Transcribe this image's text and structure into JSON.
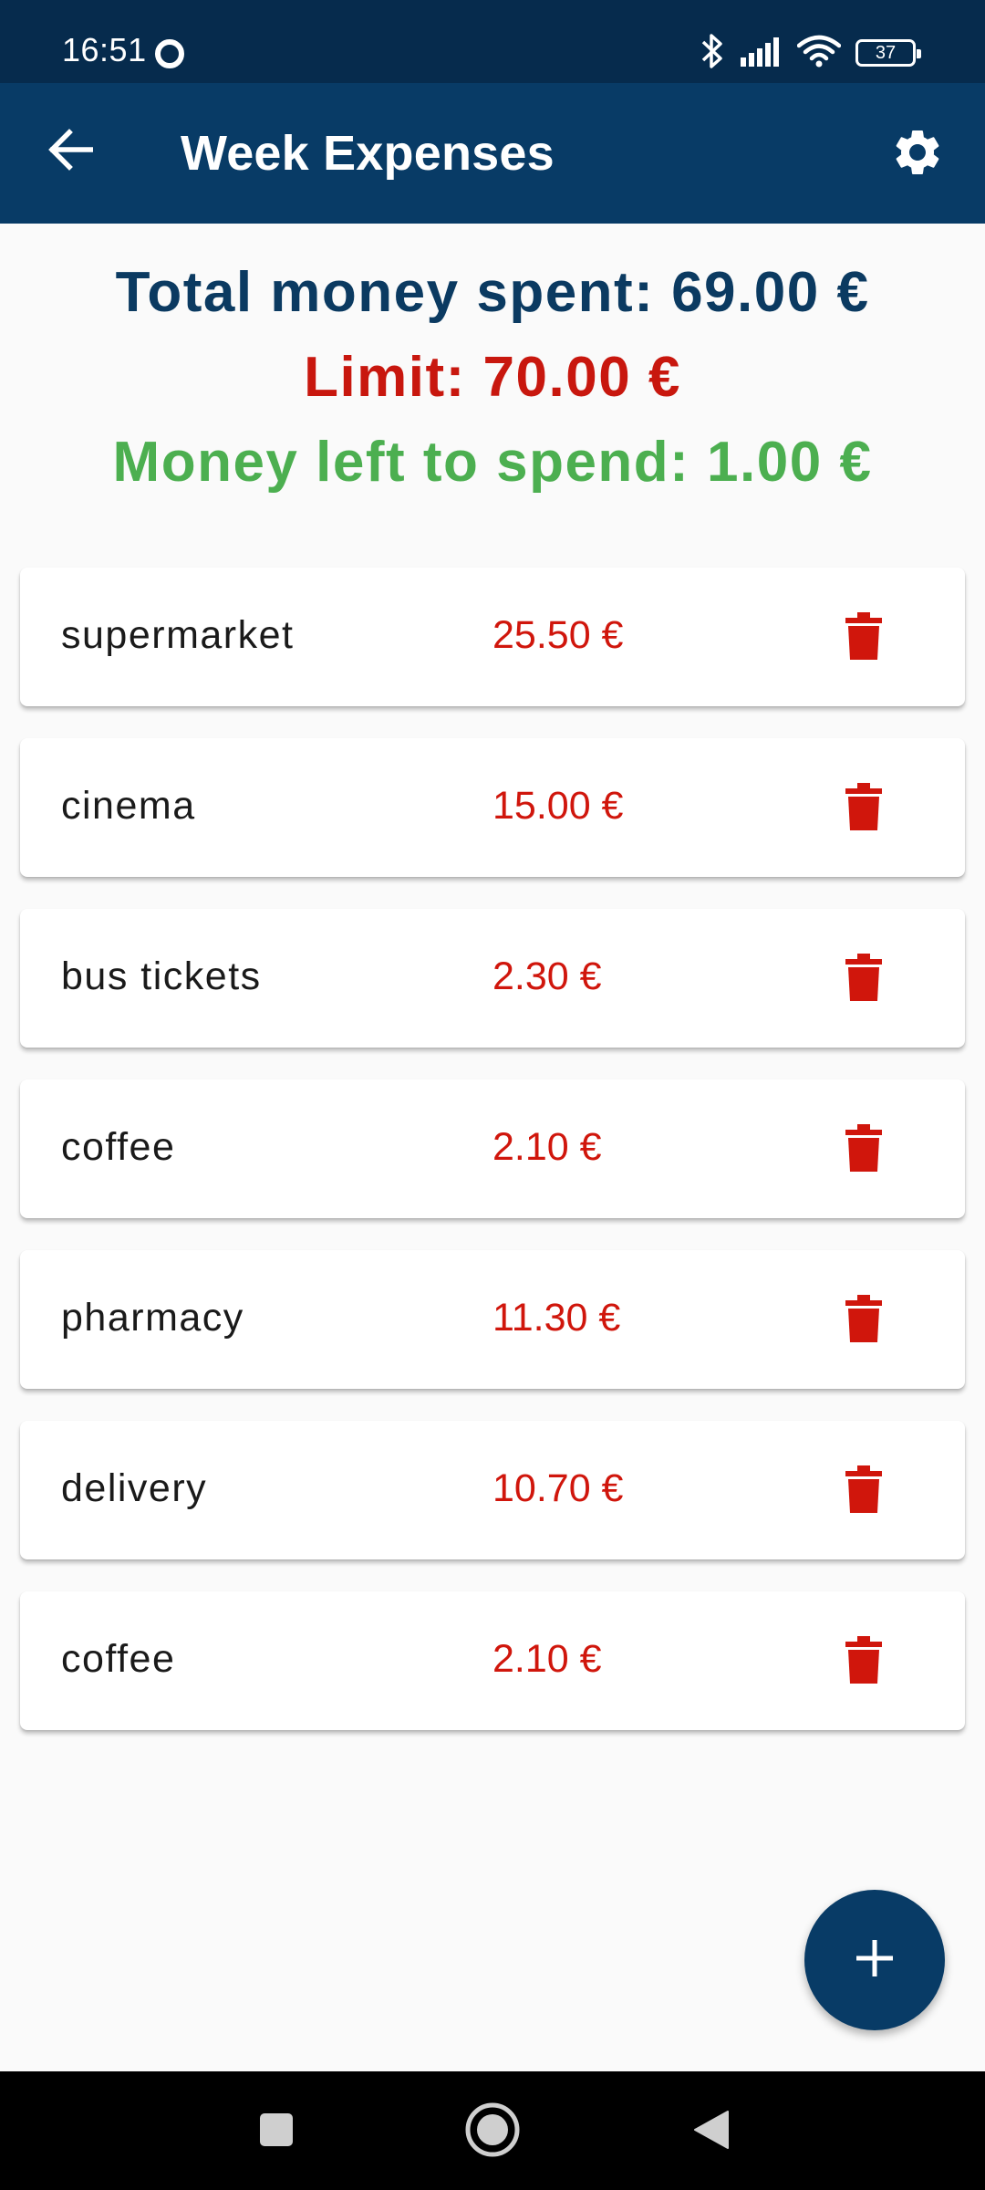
{
  "status_bar": {
    "time": "16:51",
    "battery_level": "37",
    "icons": [
      "bluetooth-icon",
      "cell-signal-icon",
      "wifi-icon",
      "battery-icon"
    ]
  },
  "app_bar": {
    "title": "Week Expenses",
    "back_icon": "arrow-back-icon",
    "settings_icon": "gear-icon"
  },
  "summary": {
    "total": "Total money spent: 69.00 €",
    "limit": "Limit: 70.00 €",
    "left": "Money left to spend: 1.00 €"
  },
  "expenses": [
    {
      "name": "supermarket",
      "amount": "25.50 €"
    },
    {
      "name": "cinema",
      "amount": "15.00 €"
    },
    {
      "name": "bus tickets",
      "amount": "2.30 €"
    },
    {
      "name": "coffee",
      "amount": "2.10 €"
    },
    {
      "name": "pharmacy",
      "amount": "11.30 €"
    },
    {
      "name": "delivery",
      "amount": "10.70 €"
    },
    {
      "name": "coffee",
      "amount": "2.10 €"
    }
  ],
  "fab": {
    "icon": "plus-icon"
  },
  "colors": {
    "app_bar": "#083b66",
    "status_bar": "#062b4d",
    "total_text": "#0b3a61",
    "limit_text": "#c8170e",
    "left_text": "#4caf50",
    "amount_text": "#d0160c",
    "delete_icon": "#d0160c"
  }
}
